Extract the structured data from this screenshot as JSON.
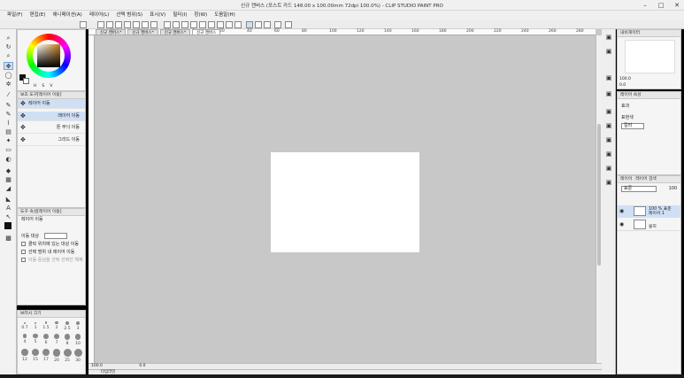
{
  "window": {
    "title": "신규 캔버스 (포스트 카드 148.00 x 100.00mm 72dpi 100.0%) - CLIP STUDIO PAINT PRO",
    "controls": [
      "–",
      "□",
      "✕"
    ]
  },
  "menu": [
    "파일(F)",
    "편집(E)",
    "애니메이션(A)",
    "레이어(L)",
    "선택 범위(S)",
    "표시(V)",
    "필터(I)",
    "창(W)",
    "도움말(H)"
  ],
  "tabs": [
    "신규 캔버스*",
    "신규 캔버스*",
    "신규 캔버스*",
    "신규 캔버스"
  ],
  "ruler_ticks": [
    "60",
    "40",
    "20",
    "0",
    "20",
    "40",
    "60",
    "80",
    "100",
    "120",
    "140",
    "160",
    "180",
    "200",
    "220",
    "240",
    "260",
    "280"
  ],
  "color": {
    "values": [
      "H",
      "S",
      "V"
    ]
  },
  "subtool_panel": {
    "header": "보조 도구[레이어 이동]",
    "group_label": "레이어 이동",
    "items": [
      "레이어 이동",
      "톤 무늬 이동",
      "그리드 이동"
    ]
  },
  "tool_property": {
    "header": "도구 속성[레이어 이동]",
    "title": "레이어 이동",
    "target_label": "이동 대상",
    "options": [
      "클릭 위치에 있는 대상 이동",
      "선택 범위 내 레이어 이동",
      "이동 중심을 선택 선택선 해제"
    ]
  },
  "brush_size": {
    "header": "브러시 크기",
    "sizes": [
      "0.7",
      "1",
      "1.5",
      "2",
      "2.5",
      "3",
      "4",
      "5",
      "6",
      "7",
      "8",
      "10",
      "12",
      "15",
      "17",
      "20",
      "25",
      "30"
    ]
  },
  "navigator": {
    "header": "내비게이터",
    "zoom": "100.0",
    "angle": "0.0"
  },
  "layer_property": {
    "header": "레이어 속성",
    "effect_label": "효과",
    "expression_label": "표현색",
    "expression_value": "컬러"
  },
  "layer_panel": {
    "tabs": [
      "레이어",
      "레이어 검색"
    ],
    "blend_mode": "표준",
    "opacity": "100",
    "layers": [
      {
        "name_line1": "100 % 표준",
        "name_line2": "레이어 1",
        "selected": true
      },
      {
        "name_line1": "",
        "name_line2": "용지",
        "selected": false
      }
    ]
  },
  "status": {
    "zoom": "100.0",
    "angle": "0.0",
    "timeline_label": "타임라인"
  },
  "colors": {
    "canvas_bg": "#c8c8c8",
    "selection": "#cfe0f5",
    "panel": "#f5f5f5"
  }
}
